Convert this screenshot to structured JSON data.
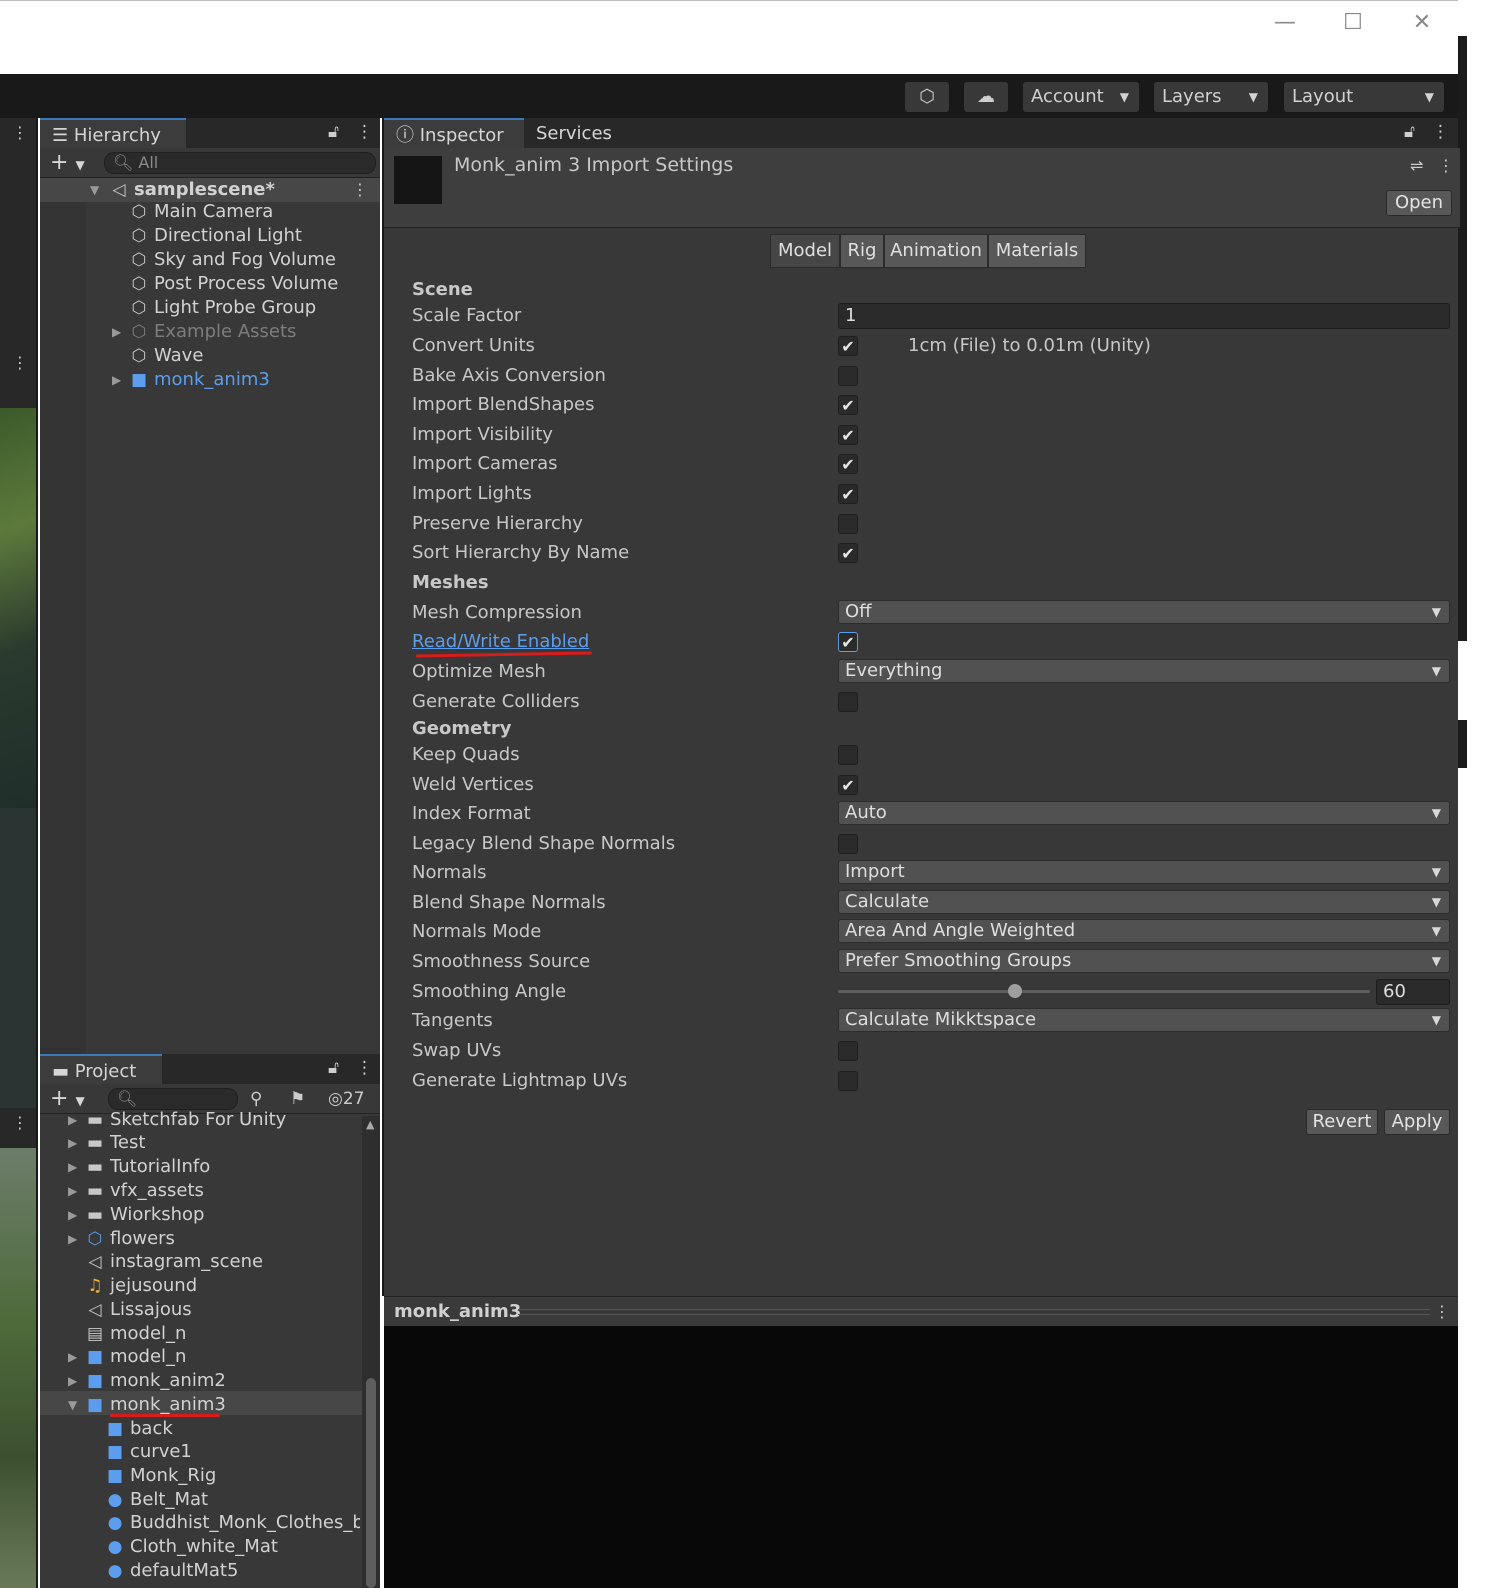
{
  "window": {
    "minimize": "—",
    "maximize": "☐",
    "close": "✕"
  },
  "toolbar": {
    "account": "Account",
    "layers": "Layers",
    "layout": "Layout"
  },
  "hierarchy": {
    "tab": "Hierarchy",
    "search_placeholder": "All",
    "scene": "samplescene*",
    "items": [
      "Main Camera",
      "Directional Light",
      "Sky and Fog Volume",
      "Post Process Volume",
      "Light Probe Group",
      "Example Assets",
      "Wave",
      "monk_anim3"
    ]
  },
  "project": {
    "tab": "Project",
    "hidden_count": "27",
    "items": [
      "Sketchfab For Unity",
      "Test",
      "TutorialInfo",
      "vfx_assets",
      "Wiorkshop",
      "flowers",
      "instagram_scene",
      "jejusound",
      "Lissajous",
      "model_n",
      "model_n",
      "monk_anim2",
      "monk_anim3",
      "back",
      "curve1",
      "Monk_Rig",
      "Belt_Mat",
      "Buddhist_Monk_Clothes_bo",
      "Cloth_white_Mat",
      "defaultMat5"
    ]
  },
  "inspector": {
    "tab": "Inspector",
    "tab2": "Services",
    "title": "Monk_anim 3 Import Settings",
    "open": "Open",
    "subtabs": [
      "Model",
      "Rig",
      "Animation",
      "Materials"
    ],
    "sections": {
      "scene": "Scene",
      "meshes": "Meshes",
      "geometry": "Geometry"
    },
    "labels": {
      "scale_factor": "Scale Factor",
      "convert_units": "Convert Units",
      "bake_axis": "Bake Axis Conversion",
      "import_blendshapes": "Import BlendShapes",
      "import_visibility": "Import Visibility",
      "import_cameras": "Import Cameras",
      "import_lights": "Import Lights",
      "preserve_hierarchy": "Preserve Hierarchy",
      "sort_hierarchy": "Sort Hierarchy By Name",
      "mesh_compression": "Mesh Compression",
      "read_write": "Read/Write Enabled",
      "optimize_mesh": "Optimize Mesh",
      "generate_colliders": "Generate Colliders",
      "keep_quads": "Keep Quads",
      "weld_vertices": "Weld Vertices",
      "index_format": "Index Format",
      "legacy_blend": "Legacy Blend Shape Normals",
      "normals": "Normals",
      "blend_shape_normals": "Blend Shape Normals",
      "normals_mode": "Normals Mode",
      "smoothness_source": "Smoothness Source",
      "smoothing_angle": "Smoothing Angle",
      "tangents": "Tangents",
      "swap_uvs": "Swap UVs",
      "generate_lightmap_uvs": "Generate Lightmap UVs"
    },
    "values": {
      "scale_factor": "1",
      "convert_units_note": "1cm (File) to 0.01m (Unity)",
      "mesh_compression": "Off",
      "optimize_mesh": "Everything",
      "index_format": "Auto",
      "normals": "Import",
      "blend_shape_normals": "Calculate",
      "normals_mode": "Area And Angle Weighted",
      "smoothness_source": "Prefer Smoothing Groups",
      "smoothing_angle": "60",
      "smoothing_angle_fraction": 0.333,
      "tangents": "Calculate Mikktspace"
    },
    "checks": {
      "convert_units": true,
      "bake_axis": false,
      "import_blendshapes": true,
      "import_visibility": true,
      "import_cameras": true,
      "import_lights": true,
      "preserve_hierarchy": false,
      "sort_hierarchy": true,
      "read_write": true,
      "generate_colliders": false,
      "keep_quads": false,
      "weld_vertices": true,
      "legacy_blend": false,
      "swap_uvs": false,
      "generate_lightmap_uvs": false
    },
    "revert": "Revert",
    "apply": "Apply",
    "preview_title": "monk_anim3"
  },
  "colors": {
    "accent": "#3a79bb",
    "link_blue": "#5c9ded",
    "annotation_red": "#d81b1b"
  }
}
